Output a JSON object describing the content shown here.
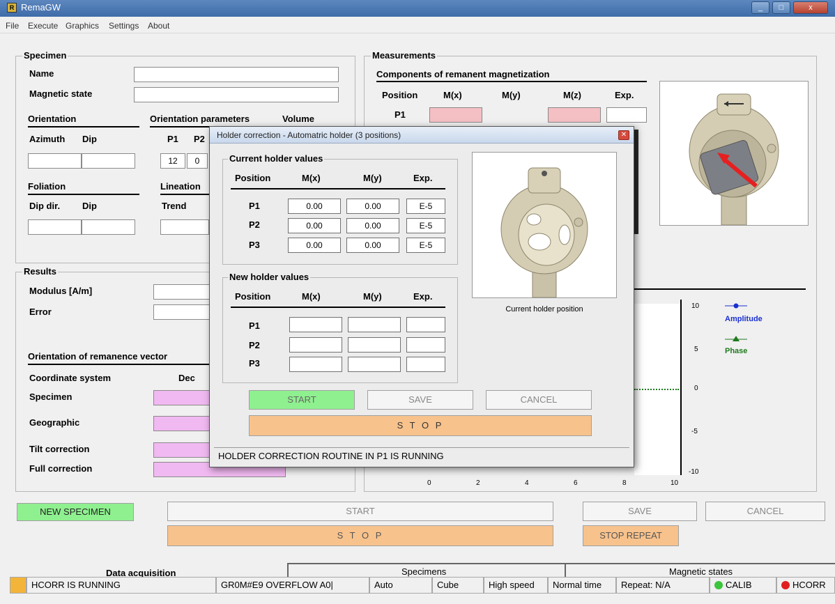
{
  "window": {
    "title": "RemaGW",
    "min": "_",
    "max": "□",
    "close": "x"
  },
  "menu": [
    "File",
    "Execute",
    "Graphics",
    "Settings",
    "About"
  ],
  "specimen": {
    "title": "Specimen",
    "name_label": "Name",
    "name_value": "",
    "magstate_label": "Magnetic state",
    "magstate_value": "",
    "orientation_label": "Orientation",
    "orientation_params_label": "Orientation parameters",
    "volume_label": "Volume",
    "azimuth_label": "Azimuth",
    "dip_label": "Dip",
    "p1_label": "P1",
    "p2_label": "P2",
    "p1_value": "12",
    "p2_value": "0",
    "foliation_label": "Foliation",
    "lineation_label": "Lineation",
    "dipdir_label": "Dip dir.",
    "dip2_label": "Dip",
    "trend_label": "Trend"
  },
  "results": {
    "title": "Results",
    "modulus_label": "Modulus [A/m]",
    "error_label": "Error",
    "orient_title": "Orientation of remanence vector",
    "coord_label": "Coordinate system",
    "dec_label": "Dec",
    "rows": [
      "Specimen",
      "Geographic",
      "Tilt correction",
      "Full correction"
    ]
  },
  "measurements": {
    "title": "Measurements",
    "components_title": "Components of remanent magnetization",
    "headers": [
      "Position",
      "M(x)",
      "M(y)",
      "M(z)",
      "Exp."
    ],
    "p1_label": "P1"
  },
  "chart": {
    "y_ticks": [
      "10",
      "5",
      "0",
      "-5",
      "-10"
    ],
    "x_ticks": [
      "0",
      "2",
      "4",
      "6",
      "8",
      "10"
    ],
    "legend_amplitude": "Amplitude",
    "legend_phase": "Phase",
    "colors": {
      "amplitude": "#1a2fd1",
      "phase": "#1f7a1f"
    }
  },
  "dialog": {
    "title": "Holder correction - Automatric holder (3 positions)",
    "current_title": "Current holder values",
    "new_title": "New holder values",
    "headers": [
      "Position",
      "M(x)",
      "M(y)",
      "Exp."
    ],
    "current_rows": [
      {
        "pos": "P1",
        "mx": "0.00",
        "my": "0.00",
        "exp": "E-5"
      },
      {
        "pos": "P2",
        "mx": "0.00",
        "my": "0.00",
        "exp": "E-5"
      },
      {
        "pos": "P3",
        "mx": "0.00",
        "my": "0.00",
        "exp": "E-5"
      }
    ],
    "new_rows": [
      {
        "pos": "P1",
        "mx": "",
        "my": "",
        "exp": ""
      },
      {
        "pos": "P2",
        "mx": "",
        "my": "",
        "exp": ""
      },
      {
        "pos": "P3",
        "mx": "",
        "my": "",
        "exp": ""
      }
    ],
    "image_caption": "Current holder position",
    "start": "START",
    "save": "SAVE",
    "cancel": "CANCEL",
    "stop": "S T O P",
    "status": "HOLDER CORRECTION ROUTINE IN P1 IS RUNNING"
  },
  "buttons": {
    "new_specimen": "NEW SPECIMEN",
    "start": "START",
    "save": "SAVE",
    "cancel": "CANCEL",
    "stop": "S T O P",
    "stop_repeat": "STOP REPEAT"
  },
  "bottom_tabs": {
    "data_acq": "Data acquisition",
    "specimens": "Specimens",
    "mag_states": "Magnetic states"
  },
  "statusbar": {
    "hcorr_running": "HCORR IS RUNNING",
    "device": "GR0M#E9 OVERFLOW A0|",
    "mode": "Auto",
    "shape": "Cube",
    "speed": "High speed",
    "time": "Normal time",
    "repeat": "Repeat: N/A",
    "calib": "CALIB",
    "hcorr": "HCORR",
    "colors": {
      "indicator": "#f3b43a",
      "calib": "#3cc43c",
      "hcorr": "#e02020"
    }
  }
}
